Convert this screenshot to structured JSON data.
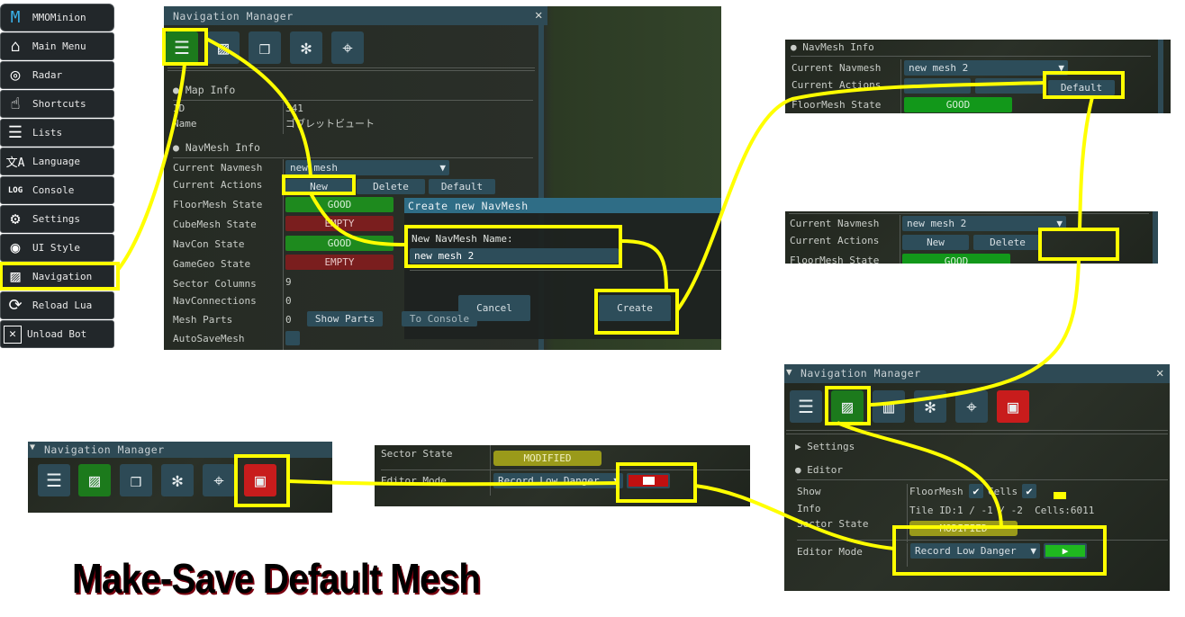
{
  "sidebar": {
    "items": [
      {
        "label": "MMOMinion",
        "icon": "mmominion-logo-icon"
      },
      {
        "label": "Main Menu",
        "icon": "hierarchy-icon"
      },
      {
        "label": "Radar",
        "icon": "radar-icon"
      },
      {
        "label": "Shortcuts",
        "icon": "hand-pointer-icon"
      },
      {
        "label": "Lists",
        "icon": "list-icon"
      },
      {
        "label": "Language",
        "icon": "translate-icon"
      },
      {
        "label": "Console",
        "icon": "log-file-icon"
      },
      {
        "label": "Settings",
        "icon": "gear-icon"
      },
      {
        "label": "UI Style",
        "icon": "eye-icon"
      },
      {
        "label": "Navigation",
        "icon": "map-gear-icon"
      },
      {
        "label": "Reload Lua",
        "icon": "reload-icon"
      },
      {
        "label": "Unload Bot",
        "icon": "close-icon"
      }
    ]
  },
  "navmgr": {
    "title": "Navigation Manager",
    "map_info": "Map Info",
    "id_label": "ID",
    "id_value": "341",
    "name_label": "Name",
    "name_value": "ゴブレットビュート",
    "navmesh_info": "NavMesh Info",
    "current_navmesh_label": "Current Navmesh",
    "current_navmesh": "new mesh",
    "current_actions_label": "Current Actions",
    "new": "New",
    "delete": "Delete",
    "default": "Default",
    "rows": [
      {
        "label": "FloorMesh State",
        "value": "GOOD",
        "status": "good"
      },
      {
        "label": "CubeMesh State",
        "value": "EMPTY",
        "status": "empty"
      },
      {
        "label": "NavCon State",
        "value": "GOOD",
        "status": "good"
      },
      {
        "label": "GameGeo State",
        "value": "EMPTY",
        "status": "empty"
      }
    ],
    "sector_columns_label": "Sector Columns",
    "sector_columns": "9",
    "navconnections_label": "NavConnections",
    "navconnections": "0",
    "mesh_parts_label": "Mesh Parts",
    "mesh_parts": "0",
    "show_parts": "Show Parts",
    "to_console": "To Console",
    "autosave_label": "AutoSaveMesh"
  },
  "dialog": {
    "title": "Create new NavMesh",
    "name_label": "New NavMesh Name:",
    "name_value": "new mesh 2",
    "cancel": "Cancel",
    "create": "Create"
  },
  "panel_b": {
    "section": "NavMesh Info",
    "current_navmesh_label": "Current Navmesh",
    "current_navmesh": "new mesh 2",
    "current_actions_label": "Current Actions",
    "default": "Default",
    "floormesh_label": "FloorMesh State",
    "floormesh": "GOOD"
  },
  "panel_c": {
    "current_navmesh_label": "Current Navmesh",
    "current_navmesh": "new mesh 2",
    "current_actions_label": "Current Actions",
    "new": "New",
    "delete": "Delete",
    "floormesh_label": "FloorMesh State",
    "floormesh": "GOOD"
  },
  "panel_d": {
    "title": "Navigation Manager",
    "settings": "Settings",
    "editor": "Editor",
    "show_label": "Show",
    "floormesh": "FloorMesh",
    "cells": "Cells",
    "info_label": "Info",
    "tile_id_label": "Tile ID:",
    "tile_id": "1 / -1 / -2",
    "cells_label": "Cells:",
    "cells_value": "6011",
    "sector_state_label": "Sector State",
    "sector_state": "MODIFIED",
    "editor_mode_label": "Editor Mode",
    "editor_mode": "Record Low Danger"
  },
  "panel_e": {
    "title": "Navigation Manager"
  },
  "panel_f": {
    "sector_state_label": "Sector State",
    "sector_state": "MODIFIED",
    "editor_mode_label": "Editor Mode",
    "editor_mode": "Record Low Danger"
  },
  "caption": "Make-Save Default Mesh",
  "colors": {
    "highlight": "#ffff00",
    "good": "#1e8a1e",
    "empty": "#7a1e1e",
    "modified": "#9a9a1a",
    "button": "#2d4d5a",
    "save": "#c81c1c"
  }
}
